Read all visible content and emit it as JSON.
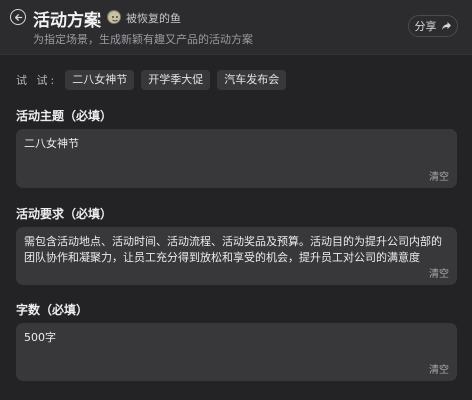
{
  "header": {
    "title": "活动方案",
    "author": "被恢复的鱼",
    "subtitle": "为指定场景，生成新颖有趣又产品的活动方案",
    "share_label": "分享",
    "back_icon": "arrow-left-icon",
    "share_icon": "share-arrow-icon"
  },
  "try": {
    "label": "试 试:",
    "chips": [
      "二八女神节",
      "开学季大促",
      "汽车发布会"
    ]
  },
  "fields": {
    "theme": {
      "label": "活动主题（必填）",
      "value": "二八女神节",
      "clear_label": "清空"
    },
    "requirements": {
      "label": "活动要求（必填）",
      "value": "需包含活动地点、活动时间、活动流程、活动奖品及预算。活动目的为提升公司内部的团队协作和凝聚力，让员工充分得到放松和享受的机会，提升员工对公司的满意度",
      "clear_label": "清空"
    },
    "word_count": {
      "label": "字数（必填）",
      "value": "500字",
      "clear_label": "清空"
    }
  },
  "colors": {
    "background": "#232325",
    "header": "#2c2c2f",
    "input": "#38383b",
    "text": "#e6e6e8"
  }
}
